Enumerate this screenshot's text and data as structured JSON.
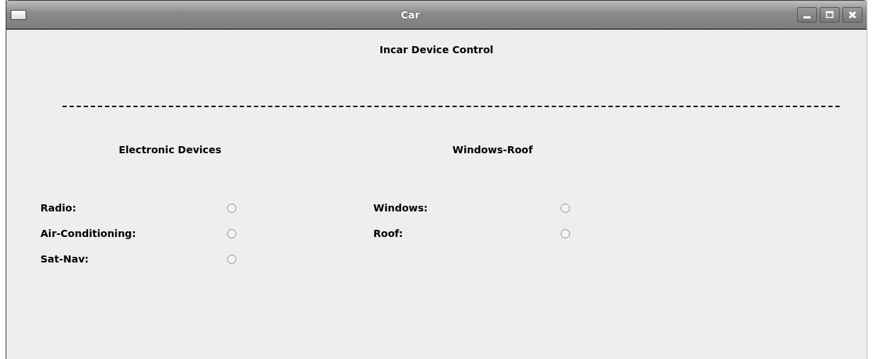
{
  "window": {
    "title": "Car"
  },
  "heading": "Incar Device Control",
  "groups": [
    {
      "title": "Electronic Devices",
      "items": [
        {
          "label": "Radio:",
          "selected": false
        },
        {
          "label": "Air-Conditioning:",
          "selected": false
        },
        {
          "label": "Sat-Nav:",
          "selected": false
        }
      ]
    },
    {
      "title": "Windows-Roof",
      "items": [
        {
          "label": "Windows:",
          "selected": false
        },
        {
          "label": "Roof:",
          "selected": false
        }
      ]
    }
  ]
}
